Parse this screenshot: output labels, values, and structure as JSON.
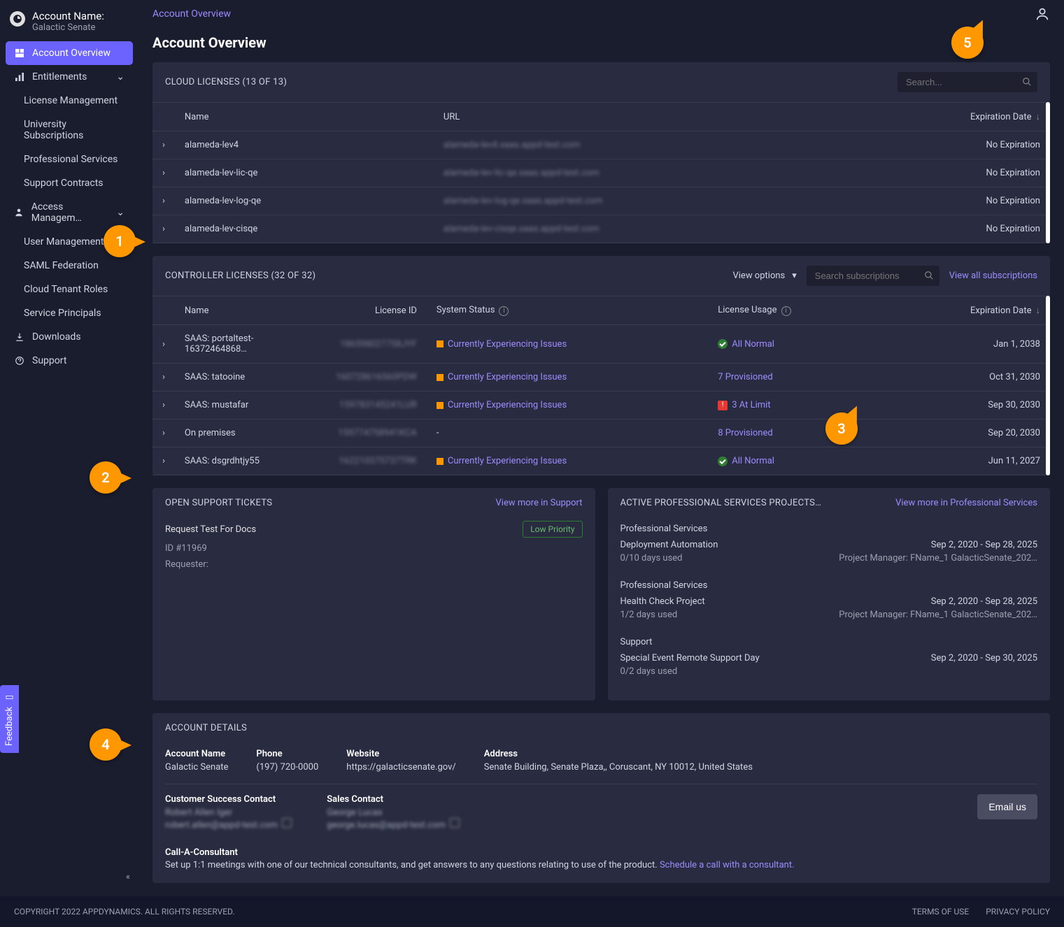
{
  "account": {
    "label": "Account Name:",
    "name": "Galactic Senate"
  },
  "sidebar": {
    "items": [
      {
        "label": "Account Overview"
      },
      {
        "label": "Entitlements"
      },
      {
        "label": "Access Managem…"
      },
      {
        "label": "Downloads"
      },
      {
        "label": "Support"
      }
    ],
    "entitlements_sub": [
      {
        "label": "License Management"
      },
      {
        "label": "University Subscriptions"
      },
      {
        "label": "Professional Services"
      },
      {
        "label": "Support Contracts"
      }
    ],
    "access_sub": [
      {
        "label": "User Management"
      },
      {
        "label": "SAML Federation"
      },
      {
        "label": "Cloud Tenant Roles"
      },
      {
        "label": "Service Principals"
      }
    ]
  },
  "breadcrumb": "Account Overview",
  "page_title": "Account Overview",
  "cloud_panel": {
    "title": "CLOUD LICENSES (13 OF 13)",
    "search_placeholder": "Search...",
    "cols": {
      "name": "Name",
      "url": "URL",
      "exp": "Expiration Date"
    },
    "rows": [
      {
        "name": "alameda-lev4",
        "url": "alameda-lev4.saas.appd-test.com",
        "exp": "No Expiration"
      },
      {
        "name": "alameda-lev-lic-qe",
        "url": "alameda-lev-lic-qe.saas.appd-test.com",
        "exp": "No Expiration"
      },
      {
        "name": "alameda-lev-log-qe",
        "url": "alameda-lev-log-qe.saas.appd-test.com",
        "exp": "No Expiration"
      },
      {
        "name": "alameda-lev-cisqe",
        "url": "alameda-lev-cisqe.saas.appd-test.com",
        "exp": "No Expiration"
      }
    ]
  },
  "controller_panel": {
    "title": "CONTROLLER LICENSES (32 OF 32)",
    "view_options": "View options",
    "search_placeholder": "Search subscriptions",
    "view_all": "View all subscriptions",
    "cols": {
      "name": "Name",
      "lic": "License ID",
      "status": "System Status",
      "usage": "License Usage",
      "exp": "Expiration Date"
    },
    "rows": [
      {
        "name": "SAAS: portaltest-16372464868…",
        "lic": "186598027758JYF",
        "status": "Currently Experiencing Issues",
        "usage": "All Normal",
        "usage_type": "ok",
        "exp": "Jan 1, 2038"
      },
      {
        "name": "SAAS: tatooine",
        "lic": "160728616560PDW",
        "status": "Currently Experiencing Issues",
        "usage": "7 Provisioned",
        "usage_type": "link",
        "exp": "Oct 31, 2030"
      },
      {
        "name": "SAAS: mustafar",
        "lic": "159783145241LUR",
        "status": "Currently Experiencing Issues",
        "usage": "3 At Limit",
        "usage_type": "limit",
        "exp": "Sep 30, 2030"
      },
      {
        "name": "On premises",
        "lic": "159774758941KCA",
        "status": "-",
        "usage": "8 Provisioned",
        "usage_type": "link",
        "exp": "Sep 20, 2030"
      },
      {
        "name": "SAAS: dsgrdhtjy55",
        "lic": "162210375737TRK",
        "status": "Currently Experiencing Issues",
        "usage": "All Normal",
        "usage_type": "ok",
        "exp": "Jun 11, 2027"
      }
    ]
  },
  "tickets_panel": {
    "title": "OPEN SUPPORT TICKETS",
    "view_more": "View more in Support",
    "ticket_title": "Request Test For Docs",
    "priority": "Low Priority",
    "id": "ID #11969",
    "requester": "Requester:"
  },
  "ps_panel": {
    "title": "ACTIVE PROFESSIONAL SERVICES PROJECTS (…",
    "view_more": "View more in Professional Services",
    "items": [
      {
        "cat": "Professional Services",
        "name": "Deployment Automation",
        "dates": "Sep 2, 2020 - Sep 28, 2025",
        "days": "0/10 days used",
        "pm": "Project Manager: FName_1 GalacticSenate_202…"
      },
      {
        "cat": "Professional Services",
        "name": "Health Check Project",
        "dates": "Sep 2, 2020 - Sep 28, 2025",
        "days": "1/2 days used",
        "pm": "Project Manager: FName_1 GalacticSenate_202…"
      },
      {
        "cat": "Support",
        "name": "Special Event Remote Support Day",
        "dates": "Sep 2, 2020 - Sep 30, 2025",
        "days": "0/2 days used",
        "pm": ""
      }
    ]
  },
  "details_panel": {
    "title": "ACCOUNT DETAILS",
    "cols": {
      "account_name": {
        "label": "Account Name",
        "value": "Galactic Senate"
      },
      "phone": {
        "label": "Phone",
        "value": "(197) 720-0000"
      },
      "website": {
        "label": "Website",
        "value": "https://galacticsenate.gov/"
      },
      "address": {
        "label": "Address",
        "value": "Senate Building, Senate Plaza,, Coruscant, NY 10012, United States"
      }
    },
    "contacts": {
      "csc": {
        "label": "Customer Success Contact",
        "name": "Robert Allen Iger",
        "email": "robert.allen@appd-test.com"
      },
      "sales": {
        "label": "Sales Contact",
        "name": "George Lucas",
        "email": "george.lucas@appd-test.com"
      }
    },
    "email_us": "Email us",
    "consultant": {
      "title": "Call-A-Consultant",
      "text": "Set up 1:1 meetings with one of our technical consultants, and get answers to any questions relating to use of the product. ",
      "link": "Schedule a call with a consultant."
    }
  },
  "footer": {
    "copyright": "COPYRIGHT 2022 APPDYNAMICS. ALL RIGHTS RESERVED.",
    "terms": "TERMS OF USE",
    "privacy": "PRIVACY POLICY"
  },
  "feedback": "Feedback",
  "callouts": {
    "1": "1",
    "2": "2",
    "3": "3",
    "4": "4",
    "5": "5"
  }
}
